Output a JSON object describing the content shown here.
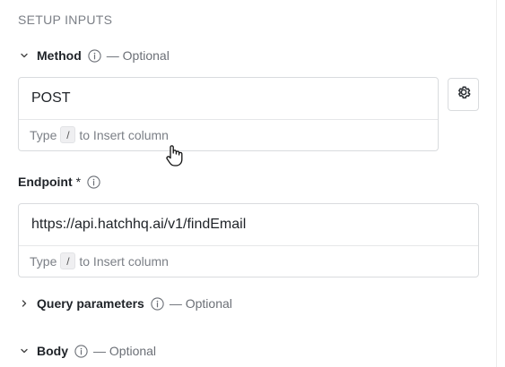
{
  "section": {
    "title": "SETUP INPUTS"
  },
  "method": {
    "label": "Method",
    "optional": "— Optional",
    "value": "POST",
    "hint_prefix": "Type",
    "hint_key": "/",
    "hint_suffix": "to Insert column",
    "expanded": true
  },
  "endpoint": {
    "label": "Endpoint",
    "required_mark": "*",
    "value": "https://api.hatchhq.ai/v1/findEmail",
    "hint_prefix": "Type",
    "hint_key": "/",
    "hint_suffix": "to Insert column"
  },
  "query_parameters": {
    "label": "Query parameters",
    "optional": "— Optional",
    "expanded": false
  },
  "body": {
    "label": "Body",
    "optional": "— Optional",
    "expanded": true
  },
  "icons": {
    "method_chevron": "chevron-down-icon",
    "query_chevron": "chevron-right-icon",
    "body_chevron": "chevron-down-icon",
    "info": "info-icon",
    "settings": "gear-icon",
    "pointer": "hand-pointer-icon"
  },
  "colors": {
    "border": "#d9dbde",
    "muted_text": "#7b7f86",
    "text": "#1f2328"
  }
}
